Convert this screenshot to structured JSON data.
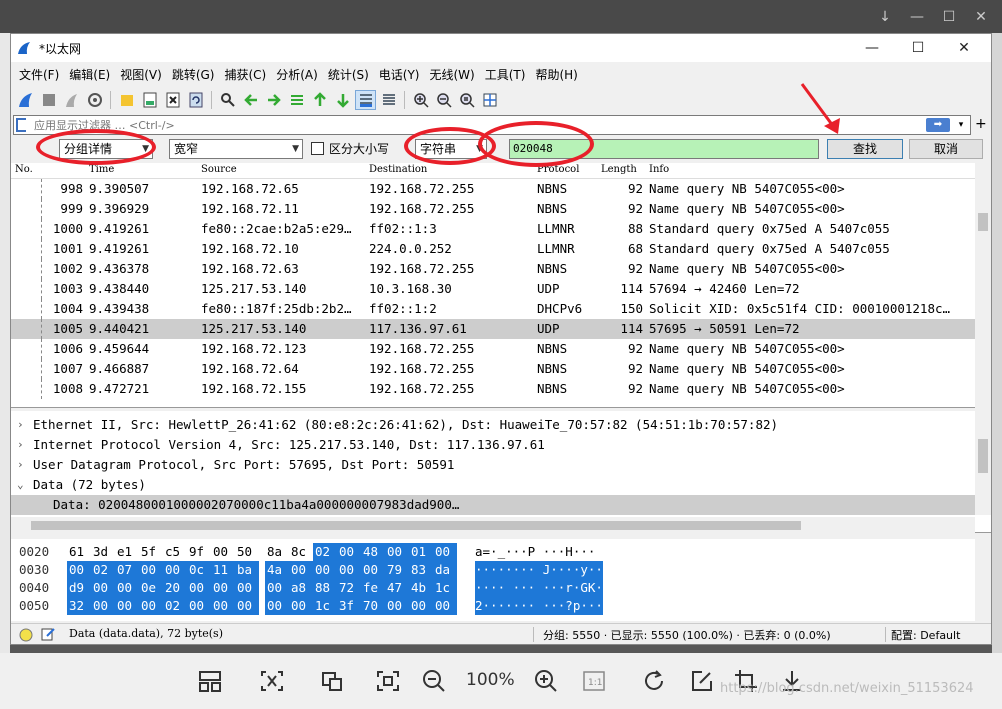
{
  "window": {
    "title": "*以太网",
    "controls": {
      "minimize": "—",
      "maximize": "☐",
      "close": "✕"
    }
  },
  "menu": [
    "文件(F)",
    "编辑(E)",
    "视图(V)",
    "跳转(G)",
    "捕获(C)",
    "分析(A)",
    "统计(S)",
    "电话(Y)",
    "无线(W)",
    "工具(T)",
    "帮助(H)"
  ],
  "filter": {
    "placeholder": "应用显示过滤器 … <Ctrl-/>"
  },
  "find": {
    "search_in": "分组详情",
    "char_width": "宽窄",
    "case_label": "区分大小写",
    "search_type": "字符串",
    "value": "020048",
    "find_label": "查找",
    "cancel_label": "取消"
  },
  "packet_list": {
    "columns": [
      "No.",
      "Time",
      "Source",
      "Destination",
      "Protocol",
      "Length",
      "Info"
    ],
    "rows": [
      {
        "no": "998",
        "time": "9.390507",
        "src": "192.168.72.65",
        "dst": "192.168.72.255",
        "proto": "NBNS",
        "len": "92",
        "info": "Name query NB 5407C055<00>"
      },
      {
        "no": "999",
        "time": "9.396929",
        "src": "192.168.72.11",
        "dst": "192.168.72.255",
        "proto": "NBNS",
        "len": "92",
        "info": "Name query NB 5407C055<00>"
      },
      {
        "no": "1000",
        "time": "9.419261",
        "src": "fe80::2cae:b2a5:e29…",
        "dst": "ff02::1:3",
        "proto": "LLMNR",
        "len": "88",
        "info": "Standard query 0x75ed A 5407c055"
      },
      {
        "no": "1001",
        "time": "9.419261",
        "src": "192.168.72.10",
        "dst": "224.0.0.252",
        "proto": "LLMNR",
        "len": "68",
        "info": "Standard query 0x75ed A 5407c055"
      },
      {
        "no": "1002",
        "time": "9.436378",
        "src": "192.168.72.63",
        "dst": "192.168.72.255",
        "proto": "NBNS",
        "len": "92",
        "info": "Name query NB 5407C055<00>"
      },
      {
        "no": "1003",
        "time": "9.438440",
        "src": "125.217.53.140",
        "dst": "10.3.168.30",
        "proto": "UDP",
        "len": "114",
        "info": "57694 → 42460 Len=72"
      },
      {
        "no": "1004",
        "time": "9.439438",
        "src": "fe80::187f:25db:2b2…",
        "dst": "ff02::1:2",
        "proto": "DHCPv6",
        "len": "150",
        "info": "Solicit XID: 0x5c51f4 CID: 00010001218c…"
      },
      {
        "no": "1005",
        "time": "9.440421",
        "src": "125.217.53.140",
        "dst": "117.136.97.61",
        "proto": "UDP",
        "len": "114",
        "info": "57695 → 50591 Len=72"
      },
      {
        "no": "1006",
        "time": "9.459644",
        "src": "192.168.72.123",
        "dst": "192.168.72.255",
        "proto": "NBNS",
        "len": "92",
        "info": "Name query NB 5407C055<00>"
      },
      {
        "no": "1007",
        "time": "9.466887",
        "src": "192.168.72.64",
        "dst": "192.168.72.255",
        "proto": "NBNS",
        "len": "92",
        "info": "Name query NB 5407C055<00>"
      },
      {
        "no": "1008",
        "time": "9.472721",
        "src": "192.168.72.155",
        "dst": "192.168.72.255",
        "proto": "NBNS",
        "len": "92",
        "info": "Name query NB 5407C055<00>"
      }
    ]
  },
  "details": [
    {
      "exp": "›",
      "text": "Ethernet II, Src: HewlettP_26:41:62 (80:e8:2c:26:41:62), Dst: HuaweiTe_70:57:82 (54:51:1b:70:57:82)"
    },
    {
      "exp": "›",
      "text": "Internet Protocol Version 4, Src: 125.217.53.140, Dst: 117.136.97.61"
    },
    {
      "exp": "›",
      "text": "User Datagram Protocol, Src Port: 57695, Dst Port: 50591"
    },
    {
      "exp": "⌄",
      "text": "Data (72 bytes)"
    },
    {
      "exp": "",
      "text": "Data: 0200480001000002070000c11ba4a000000007983dad900…"
    }
  ],
  "hex": [
    {
      "offset": "0020",
      "bytes": [
        "61",
        "3d",
        "e1",
        "5f",
        "c5",
        "9f",
        "00",
        "50",
        "8a",
        "8c",
        "02",
        "00",
        "48",
        "00",
        "01",
        "00"
      ],
      "ascii": "a=·_···P ···H···"
    },
    {
      "offset": "0030",
      "bytes": [
        "00",
        "02",
        "07",
        "00",
        "00",
        "0c",
        "11",
        "ba",
        "4a",
        "00",
        "00",
        "00",
        "00",
        "79",
        "83",
        "da"
      ],
      "ascii": "········ J····y··"
    },
    {
      "offset": "0040",
      "bytes": [
        "d9",
        "00",
        "00",
        "0e",
        "20",
        "00",
        "00",
        "00",
        "00",
        "a8",
        "88",
        "72",
        "fe",
        "47",
        "4b",
        "1c"
      ],
      "ascii": "···· ··· ···r·GK·"
    },
    {
      "offset": "0050",
      "bytes": [
        "32",
        "00",
        "00",
        "00",
        "02",
        "00",
        "00",
        "00",
        "00",
        "00",
        "1c",
        "3f",
        "70",
        "00",
        "00",
        "00"
      ],
      "ascii": "2······· ···?p···"
    }
  ],
  "status": {
    "file_info": "Data (data.data), 72 byte(s)",
    "packets": "分组: 5550 · 已显示: 5550 (100.0%) · 已丢弃: 0 (0.0%)",
    "profile": "配置: Default"
  },
  "viewer": {
    "zoom": "100%",
    "watermark": "https://blog.csdn.net/weixin_51153624"
  },
  "colors": {
    "accent": "#1e78d7",
    "search_bg": "#b7f2b7",
    "annotation": "#e8202a",
    "selected_row": "#cdcdcd"
  }
}
